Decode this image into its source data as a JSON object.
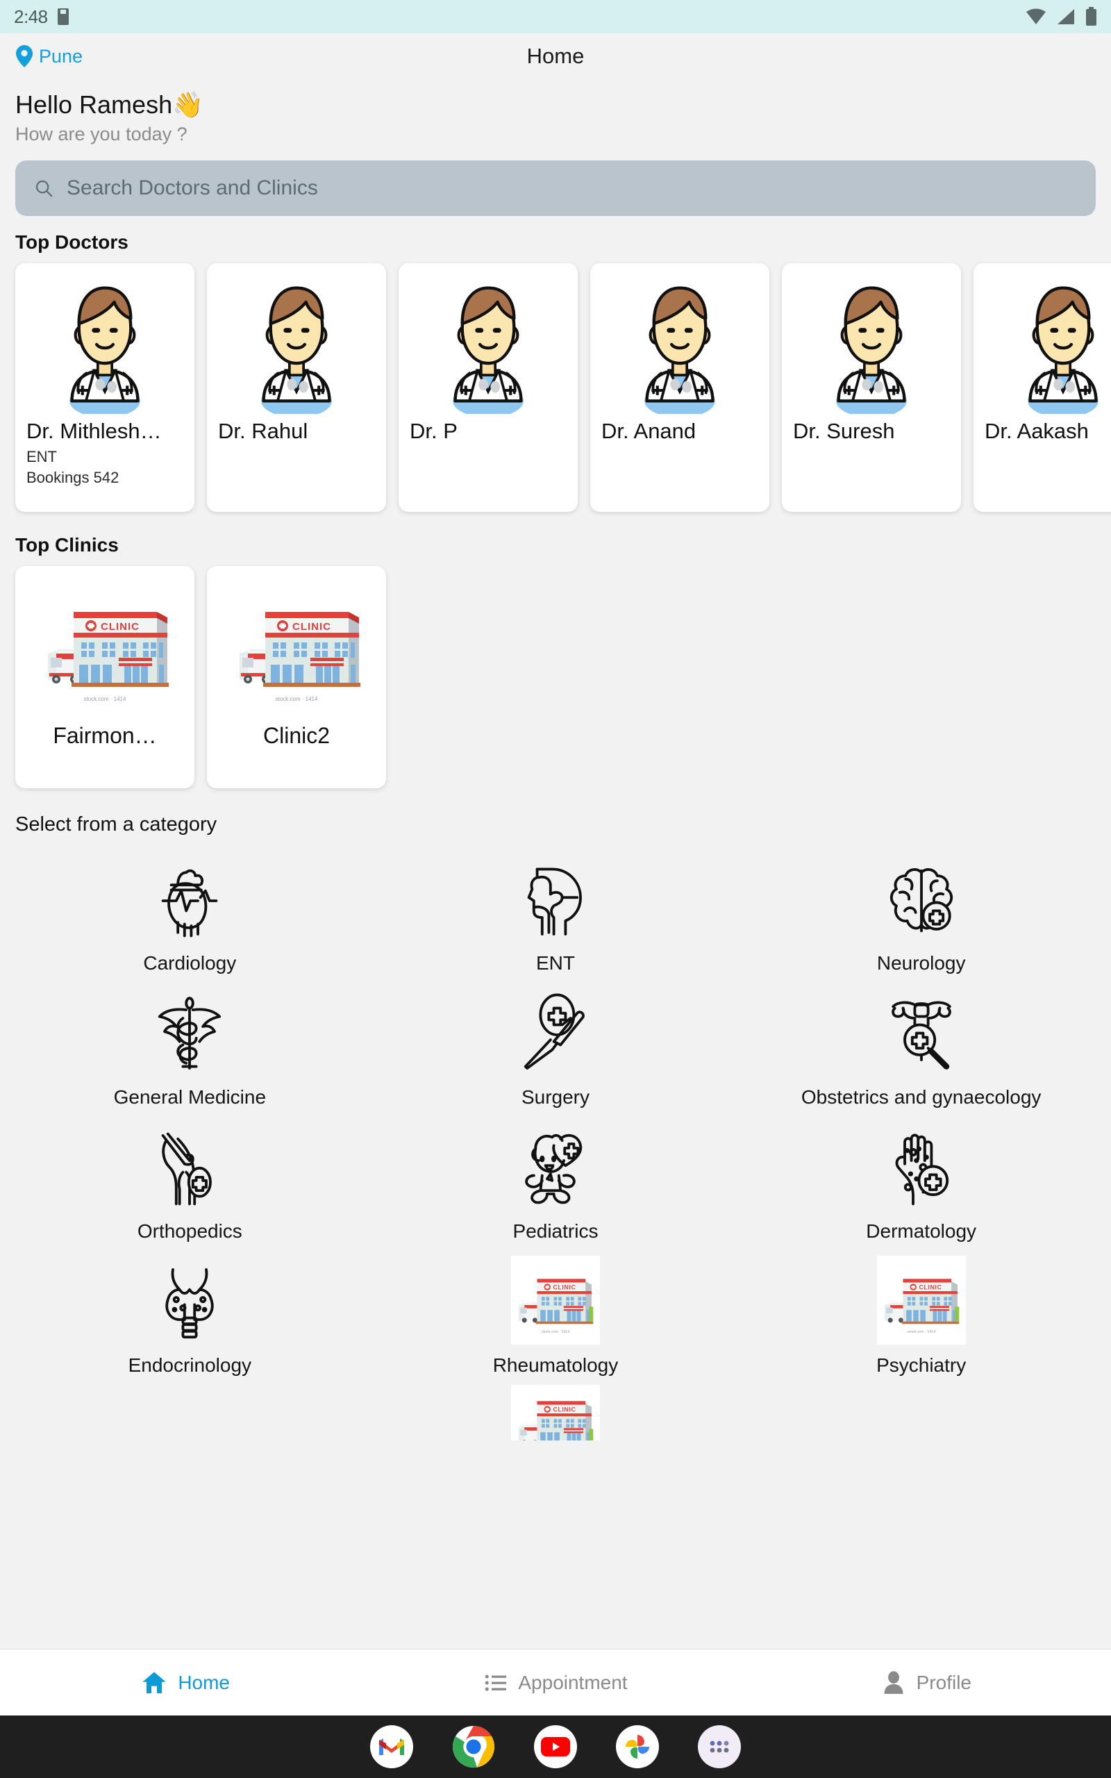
{
  "status_bar": {
    "time": "2:48",
    "icons": [
      "sim-card-icon",
      "wifi-icon",
      "cellular-signal-icon",
      "battery-icon"
    ]
  },
  "app_bar": {
    "location": "Pune",
    "location_icon": "location-pin-icon",
    "title": "Home"
  },
  "greeting": {
    "title": "Hello Ramesh",
    "emoji": "👋",
    "subtitle": "How are you today ?"
  },
  "search": {
    "placeholder": "Search Doctors and Clinics",
    "icon": "search-icon",
    "value": ""
  },
  "top_doctors": {
    "title": "Top Doctors",
    "items": [
      {
        "name": "Dr. Mithlesh…",
        "specialty": "ENT",
        "bookings": "Bookings 542"
      },
      {
        "name": "Dr. Rahul",
        "specialty": "",
        "bookings": ""
      },
      {
        "name": "Dr. P",
        "specialty": "",
        "bookings": ""
      },
      {
        "name": "Dr. Anand",
        "specialty": "",
        "bookings": ""
      },
      {
        "name": "Dr. Suresh",
        "specialty": "",
        "bookings": ""
      },
      {
        "name": "Dr. Aakash",
        "specialty": "",
        "bookings": ""
      }
    ]
  },
  "top_clinics": {
    "title": "Top Clinics",
    "items": [
      {
        "name": "Fairmon…"
      },
      {
        "name": "Clinic2"
      }
    ]
  },
  "categories": {
    "title": "Select from a category",
    "items": [
      {
        "label": "Cardiology",
        "icon": "heart-anatomy-icon"
      },
      {
        "label": "ENT",
        "icon": "head-profile-icon"
      },
      {
        "label": "Neurology",
        "icon": "brain-icon"
      },
      {
        "label": "General Medicine",
        "icon": "caduceus-icon"
      },
      {
        "label": "Surgery",
        "icon": "scalpel-icon"
      },
      {
        "label": "Obstetrics and gynaecology",
        "icon": "uterus-magnifier-icon"
      },
      {
        "label": "Orthopedics",
        "icon": "knee-joint-icon"
      },
      {
        "label": "Pediatrics",
        "icon": "baby-icon"
      },
      {
        "label": "Dermatology",
        "icon": "hand-rash-icon"
      },
      {
        "label": "Endocrinology",
        "icon": "thyroid-icon"
      },
      {
        "label": "Rheumatology",
        "icon": "clinic-placeholder-image"
      },
      {
        "label": "Psychiatry",
        "icon": "clinic-placeholder-image"
      },
      {
        "label": "",
        "icon": "clinic-placeholder-image"
      }
    ]
  },
  "bottom_nav": {
    "items": [
      {
        "label": "Home",
        "icon": "home-icon",
        "active": true
      },
      {
        "label": "Appointment",
        "icon": "list-icon",
        "active": false
      },
      {
        "label": "Profile",
        "icon": "person-icon",
        "active": false
      }
    ]
  },
  "android_dock": {
    "items": [
      {
        "name": "gmail-icon"
      },
      {
        "name": "chrome-icon"
      },
      {
        "name": "youtube-icon"
      },
      {
        "name": "google-photos-icon"
      },
      {
        "name": "app-drawer-icon"
      }
    ]
  },
  "colors": {
    "accent": "#0e9ad6",
    "status_bar_bg": "#d6f0ef",
    "page_bg": "#f2f2f2",
    "search_bg": "#b9c4cc"
  },
  "clinic_image": {
    "sign": "CLINIC",
    "watermark": "stock.com · 1414"
  }
}
